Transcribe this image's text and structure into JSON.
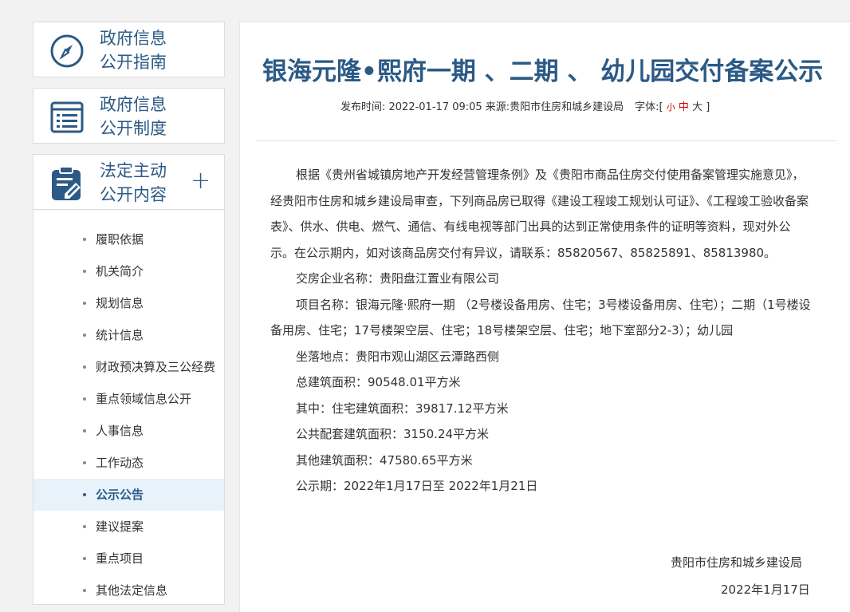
{
  "sidebar": {
    "nav": [
      {
        "line1": "政府信息",
        "line2": "公开指南",
        "icon": "compass-icon"
      },
      {
        "line1": "政府信息",
        "line2": "公开制度",
        "icon": "document-list-icon"
      },
      {
        "line1": "法定主动",
        "line2": "公开内容",
        "icon": "clipboard-edit-icon",
        "expand": "+"
      }
    ],
    "items": [
      {
        "label": "履职依据"
      },
      {
        "label": "机关简介"
      },
      {
        "label": "规划信息"
      },
      {
        "label": "统计信息"
      },
      {
        "label": "财政预决算及三公经费"
      },
      {
        "label": "重点领域信息公开"
      },
      {
        "label": "人事信息"
      },
      {
        "label": "工作动态"
      },
      {
        "label": "公示公告",
        "active": true
      },
      {
        "label": "建议提案"
      },
      {
        "label": "重点项目"
      },
      {
        "label": "其他法定信息"
      }
    ]
  },
  "article": {
    "title": "银海元隆•熙府一期 、二期 、 幼儿园交付备案公示",
    "meta": {
      "publish": "发布时间: 2022-01-17 09:05 来源:贵阳市住房和城乡建设局",
      "font_label": "字体:[",
      "font_small": "小",
      "font_mid": "中",
      "font_big": "大",
      "font_close": " ]"
    },
    "paragraphs": [
      {
        "text": "根据《贵州省城镇房地产开发经营管理条例》及《贵阳市商品住房交付使用备案管理实施意见》，经贵阳市住房和城乡建设局审查，下列商品房已取得《建设工程竣工规划认可证》、《工程竣工验收备案表》、供水、供电、燃气、通信、有线电视等部门出具的达到正常使用条件的证明等资料，现对外公示。在公示期内，如对该商品房交付有异议，请联系：85820567、85825891、85813980。"
      },
      {
        "text": "交房企业名称：贵阳盘江置业有限公司"
      },
      {
        "text": "项目名称：银海元隆·熙府一期 （2号楼设备用房、住宅；3号楼设备用房、住宅）；二期（1号楼设备用房、住宅；17号楼架空层、住宅；18号楼架空层、住宅；地下室部分2-3）；幼儿园"
      },
      {
        "text": "坐落地点：贵阳市观山湖区云潭路西侧"
      },
      {
        "text": "总建筑面积：90548.01平方米"
      },
      {
        "text": "其中：住宅建筑面积：39817.12平方米"
      },
      {
        "text": "公共配套建筑面积：3150.24平方米"
      },
      {
        "text": "其他建筑面积：47580.65平方米"
      },
      {
        "text": "公示期：2022年1月17日至 2022年1月21日"
      }
    ],
    "signature": {
      "org": "贵阳市住房和城乡建设局",
      "date": "2022年1月17日"
    }
  },
  "colors": {
    "accent": "#2b5a86",
    "font_toggle": "#cc0000",
    "active_bg": "#e8f2fb"
  }
}
